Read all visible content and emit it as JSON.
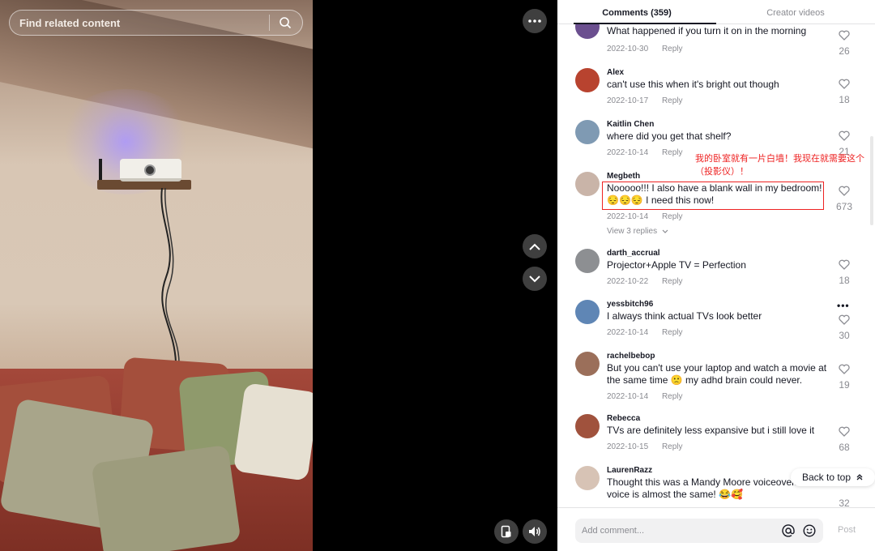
{
  "search": {
    "placeholder": "Find related content"
  },
  "tabs": {
    "comments": "Comments (359)",
    "creator": "Creator videos"
  },
  "comments": [
    {
      "user": "",
      "text": "What happened if you turn it on in the morning",
      "date": "2022-10-30",
      "reply": "Reply",
      "likes": "26",
      "avatar_color": "#6b4f8f"
    },
    {
      "user": "Alex",
      "text": "can't use this when it's bright out though",
      "date": "2022-10-17",
      "reply": "Reply",
      "likes": "18",
      "avatar_color": "#b8432f"
    },
    {
      "user": "Kaitlin Chen",
      "text": "where did you get that shelf?",
      "date": "2022-10-14",
      "reply": "Reply",
      "likes": "21",
      "avatar_color": "#7f9ab3"
    },
    {
      "user": "Megbeth",
      "text": "Nooooo!!! I also have a blank wall in my bedroom! 😔😔😔 I need this now!",
      "date": "2022-10-14",
      "reply": "Reply",
      "likes": "673",
      "replies": "View 3 replies",
      "avatar_color": "#c9b4a8"
    },
    {
      "user": "darth_accrual",
      "text": "Projector+Apple TV = Perfection",
      "date": "2022-10-22",
      "reply": "Reply",
      "likes": "18",
      "avatar_color": "#8d8f92"
    },
    {
      "user": "yessbitch96",
      "text": "I always think actual TVs look better",
      "date": "2022-10-14",
      "reply": "Reply",
      "likes": "30",
      "avatar_color": "#5f86b5"
    },
    {
      "user": "rachelbebop",
      "text": "But you can't use your laptop and watch a movie at the same time 🙁 my adhd brain could never.",
      "date": "2022-10-14",
      "reply": "Reply",
      "likes": "19",
      "avatar_color": "#9b6f5a"
    },
    {
      "user": "Rebecca",
      "text": "TVs are definitely less expansive but i still love it",
      "date": "2022-10-15",
      "reply": "Reply",
      "likes": "68",
      "avatar_color": "#a0523d"
    },
    {
      "user": "LaurenRazz",
      "text": "Thought this was a Mandy Moore voiceover. voice is almost the same! 😂🥰",
      "date": "",
      "reply": "",
      "likes": "32",
      "avatar_color": "#d7c3b5"
    }
  ],
  "annotation": "我的卧室就有一片白墙！我现在就需要这个（投影仪）！",
  "back_to_top": "Back to top",
  "footer": {
    "placeholder": "Add comment...",
    "post": "Post"
  },
  "colors": {
    "highlight": "#ee2222",
    "text": "#161823",
    "muted": "#8a8b91"
  }
}
